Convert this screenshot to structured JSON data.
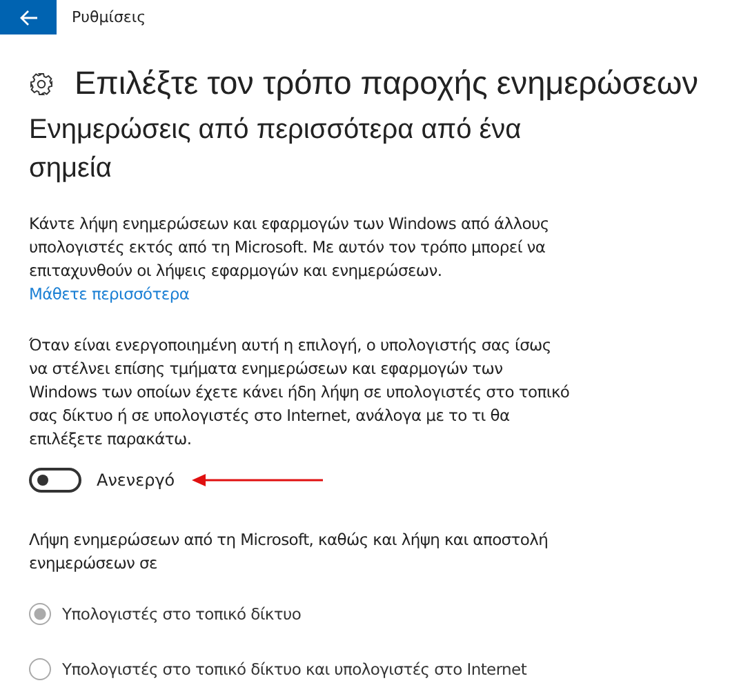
{
  "header": {
    "title": "Ρυθμίσεις"
  },
  "page_title": "Επιλέξτε τον τρόπο παροχής ενημερώσεων",
  "section_title": "Ενημερώσεις από περισσότερα από ένα σημεία",
  "description": "Κάντε λήψη ενημερώσεων και εφαρμογών των Windows από άλλους υπολογιστές εκτός από τη Microsoft. Με αυτόν τον τρόπο μπορεί να επιταχυνθούν οι λήψεις εφαρμογών και ενημερώσεων.",
  "learn_more_link": "Μάθετε περισσότερα",
  "explanation": "Όταν είναι ενεργοποιημένη αυτή η επιλογή, ο υπολογιστής σας ίσως να στέλνει επίσης τμήματα ενημερώσεων και εφαρμογών των Windows των οποίων έχετε κάνει ήδη λήψη σε υπολογιστές στο τοπικό σας δίκτυο ή σε υπολογιστές στο Internet, ανάλογα με το τι θα επιλέξετε παρακάτω.",
  "toggle": {
    "on": false,
    "label": "Ανενεργό"
  },
  "radio_intro": "Λήψη ενημερώσεων από τη Microsoft, καθώς και λήψη και αποστολή ενημερώσεων σε",
  "radio_options": [
    {
      "label": "Υπολογιστές στο τοπικό δίκτυο",
      "selected": true,
      "disabled": true
    },
    {
      "label": "Υπολογιστές στο τοπικό δίκτυο και υπολογιστές στο Internet",
      "selected": false,
      "disabled": true
    }
  ]
}
